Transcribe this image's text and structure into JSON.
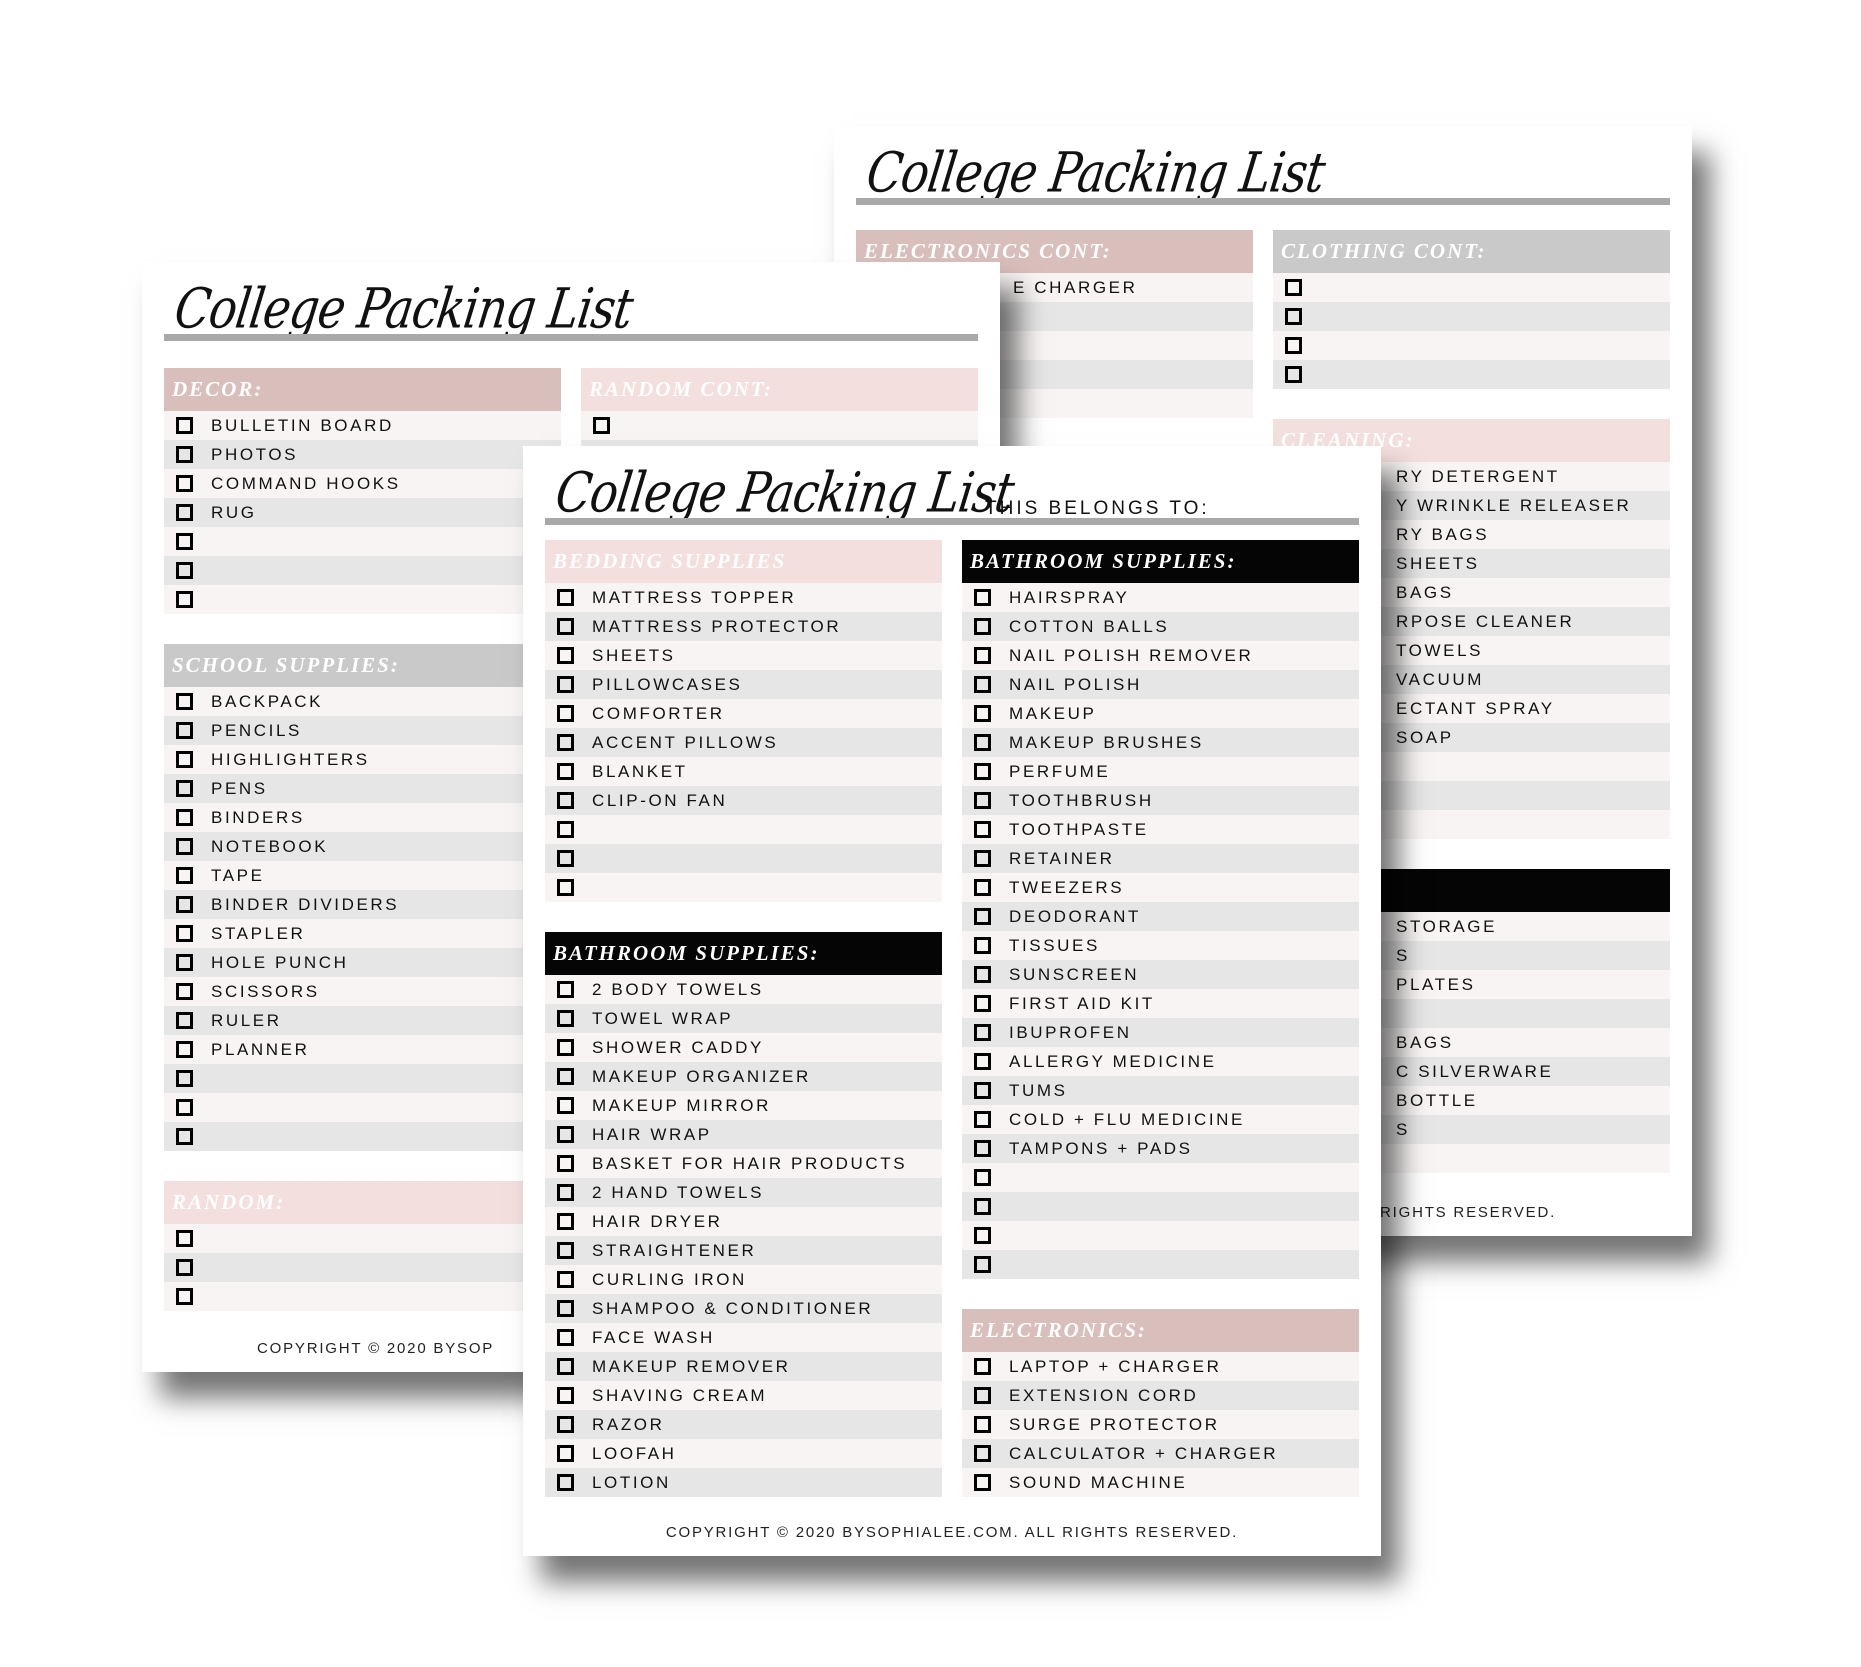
{
  "colors": {
    "pink": "#d9bfbb",
    "light_pink": "#f3dfde",
    "gray": "#c9c9c9",
    "black": "#050505",
    "row_gray": "#e6e6e6",
    "row_light": "#f8f4f4"
  },
  "pages": {
    "back": {
      "title": "College Packing List",
      "copyright": "RIGHTS RESERVED.",
      "columns": [
        {
          "cut": "cut145",
          "sections": [
            {
              "title": "ELECTRONICS CONT:",
              "style": "pink",
              "rows": [
                "E CHARGER",
                "",
                "",
                "",
                ""
              ]
            }
          ]
        },
        {
          "cut": "cut108",
          "sections": [
            {
              "title": "CLOTHING CONT:",
              "style": "gray",
              "rows": [
                "",
                "",
                "",
                ""
              ]
            },
            {
              "title": "CLEANING:",
              "style": "light",
              "rows": [
                "RY DETERGENT",
                "Y WRINKLE RELEASER",
                "RY BAGS",
                "SHEETS",
                "BAGS",
                "RPOSE CLEANER",
                "TOWELS",
                "VACUUM",
                "ECTANT SPRAY",
                "SOAP",
                "",
                "",
                ""
              ]
            },
            {
              "title": ":",
              "style": "black",
              "rows": [
                "STORAGE",
                "S",
                "PLATES",
                "",
                "BAGS",
                "C SILVERWARE",
                "BOTTLE",
                "S",
                ""
              ]
            }
          ]
        }
      ]
    },
    "left": {
      "title": "College Packing List",
      "copyright": "COPYRIGHT © 2020 BYSOP",
      "columns": [
        {
          "cut": "",
          "sections": [
            {
              "title": "DECOR:",
              "style": "pink",
              "rows": [
                "BULLETIN BOARD",
                "PHOTOS",
                "COMMAND HOOKS",
                "RUG",
                "",
                "",
                ""
              ]
            },
            {
              "title": "SCHOOL SUPPLIES:",
              "style": "gray",
              "rows": [
                "BACKPACK",
                "PENCILS",
                "HIGHLIGHTERS",
                "PENS",
                "BINDERS",
                "NOTEBOOK",
                "TAPE",
                "BINDER DIVIDERS",
                "STAPLER",
                "HOLE PUNCH",
                "SCISSORS",
                "RULER",
                "PLANNER",
                "",
                "",
                ""
              ]
            },
            {
              "title": "RANDOM:",
              "style": "light",
              "rows": [
                "",
                "",
                ""
              ]
            }
          ]
        },
        {
          "cut": "",
          "sections": [
            {
              "title": "RANDOM CONT:",
              "style": "light",
              "rows": [
                "",
                ""
              ]
            }
          ]
        }
      ]
    },
    "front": {
      "title": "College Packing List",
      "belongs_to": "THIS BELONGS TO:",
      "copyright": "COPYRIGHT © 2020 BYSOPHIALEE.COM. ALL RIGHTS RESERVED.",
      "columns": [
        {
          "cut": "",
          "sections": [
            {
              "title": "BEDDING SUPPLIES",
              "style": "light",
              "rows": [
                "MATTRESS TOPPER",
                "MATTRESS PROTECTOR",
                "SHEETS",
                "PILLOWCASES",
                "COMFORTER",
                "ACCENT PILLOWS",
                "BLANKET",
                "CLIP-ON FAN",
                "",
                "",
                ""
              ]
            },
            {
              "title": "BATHROOM SUPPLIES:",
              "style": "black",
              "rows": [
                "2 BODY TOWELS",
                "TOWEL WRAP",
                "SHOWER CADDY",
                "MAKEUP ORGANIZER",
                "MAKEUP MIRROR",
                "HAIR WRAP",
                "BASKET FOR HAIR PRODUCTS",
                "2 HAND TOWELS",
                "HAIR DRYER",
                "STRAIGHTENER",
                "CURLING IRON",
                "SHAMPOO & CONDITIONER",
                "FACE WASH",
                "MAKEUP REMOVER",
                "SHAVING CREAM",
                "RAZOR",
                "LOOFAH",
                "LOTION"
              ]
            }
          ]
        },
        {
          "cut": "",
          "sections": [
            {
              "title": "BATHROOM SUPPLIES:",
              "style": "black",
              "rows": [
                "HAIRSPRAY",
                "COTTON BALLS",
                "NAIL POLISH REMOVER",
                "NAIL POLISH",
                "MAKEUP",
                "MAKEUP BRUSHES",
                "PERFUME",
                "TOOTHBRUSH",
                "TOOTHPASTE",
                "RETAINER",
                "TWEEZERS",
                "DEODORANT",
                "TISSUES",
                "SUNSCREEN",
                "FIRST AID KIT",
                "IBUPROFEN",
                "ALLERGY MEDICINE",
                "TUMS",
                "COLD + FLU MEDICINE",
                "TAMPONS + PADS",
                "",
                "",
                "",
                ""
              ]
            },
            {
              "title": "ELECTRONICS:",
              "style": "pink",
              "rows": [
                "LAPTOP + CHARGER",
                "EXTENSION CORD",
                "SURGE PROTECTOR",
                "CALCULATOR + CHARGER",
                "SOUND MACHINE"
              ]
            }
          ]
        }
      ]
    }
  }
}
